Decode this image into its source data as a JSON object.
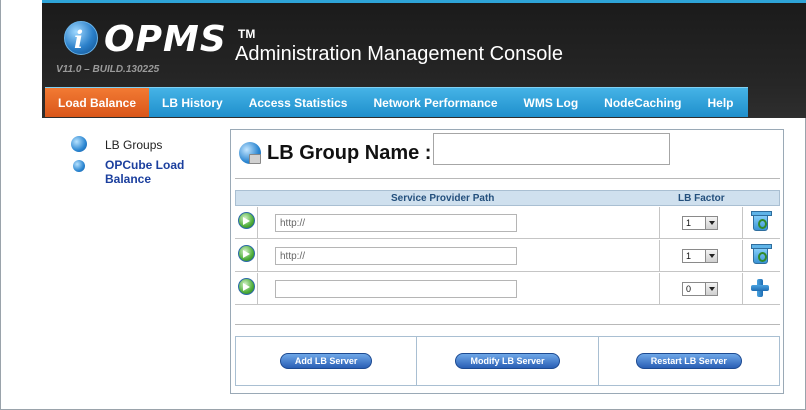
{
  "header": {
    "logo_letter": "i",
    "logo_text": "OPMS",
    "trademark": "TM",
    "version": "V11.0 – BUILD.130225",
    "console_title": "Administration Management Console"
  },
  "nav": {
    "items": [
      {
        "label": "Load Balance",
        "active": true
      },
      {
        "label": "LB History"
      },
      {
        "label": "Access Statistics"
      },
      {
        "label": "Network Performance"
      },
      {
        "label": "WMS Log"
      },
      {
        "label": "NodeCaching"
      },
      {
        "label": "Help"
      }
    ],
    "accent_color": "#2ea4d8",
    "active_color": "#e8672a"
  },
  "sidebar": {
    "groups_label": "LB Groups",
    "group_link": "OPCube Load Balance"
  },
  "main": {
    "group_name_label": "LB Group Name :",
    "group_name_value": "",
    "table": {
      "col_path": "Service Provider Path",
      "col_factor": "LB Factor",
      "rows": [
        {
          "path_placeholder": "http://",
          "factor": "1",
          "action_icon": "recycle-bin-icon"
        },
        {
          "path_placeholder": "http://",
          "factor": "1",
          "action_icon": "recycle-bin-icon"
        },
        {
          "path_placeholder": "",
          "factor": "0",
          "action_icon": "add-plus-icon"
        }
      ]
    },
    "buttons": {
      "add": "Add LB Server",
      "modify": "Modify LB Server",
      "restart": "Restart LB Server"
    }
  }
}
